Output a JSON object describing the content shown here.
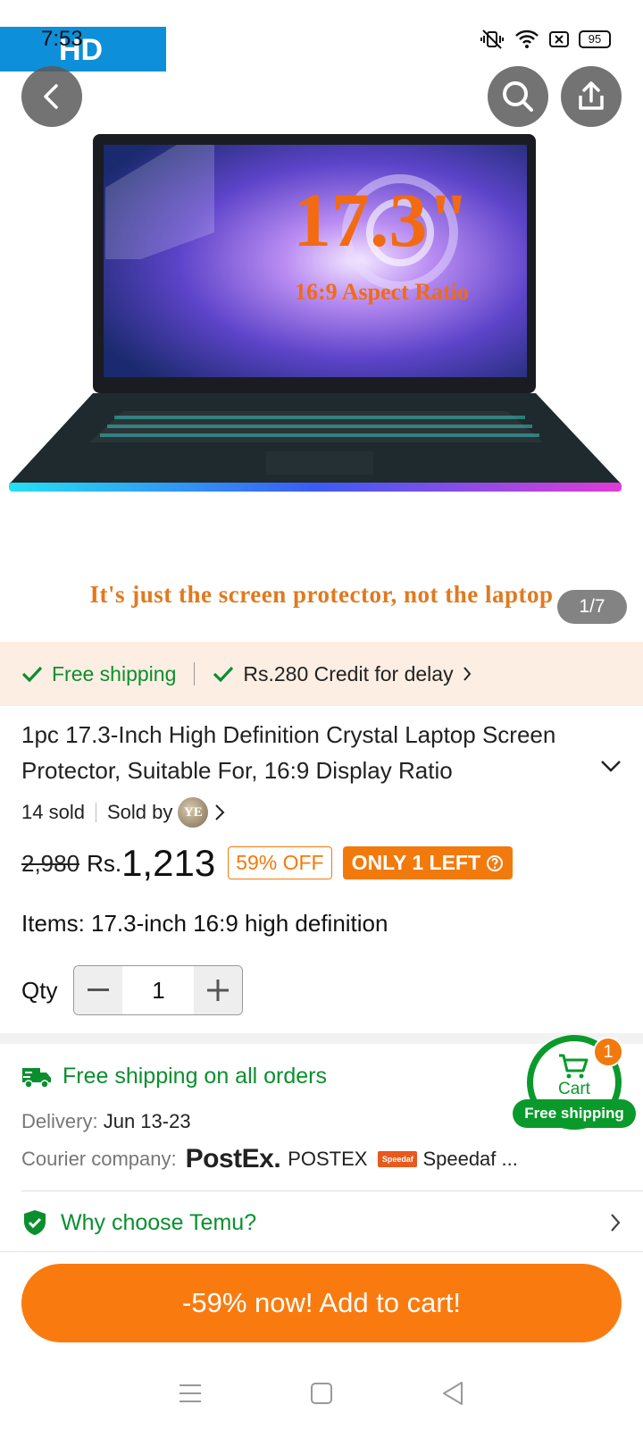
{
  "status": {
    "time": "7:53",
    "battery": "95"
  },
  "hero": {
    "hd_badge": "HD",
    "image_text_size": "17.3\"",
    "image_text_ratio": "16:9 Aspect Ratio",
    "caption": "It's just the screen protector, not the laptop",
    "counter": "1/7"
  },
  "shipping_strip": {
    "free_shipping": "Free shipping",
    "credit": "Rs.280 Credit for delay"
  },
  "product": {
    "title": "1pc 17.3-Inch High Definition Crystal Laptop Screen Protector, Suitable For, 16:9 Display Ratio",
    "sold": "14 sold",
    "sold_by": "Sold by",
    "seller_initials": "YE",
    "old_price": "2,980",
    "currency": "Rs.",
    "price": "1,213",
    "discount": "59% OFF",
    "stock": "ONLY 1 LEFT",
    "items": "Items: 17.3-inch 16:9 high definition",
    "qty_label": "Qty",
    "qty_value": "1"
  },
  "delivery": {
    "free_all": "Free shipping on all orders",
    "delivery_label": "Delivery:",
    "delivery_dates": "Jun 13-23",
    "courier_label": "Courier company:",
    "postex_logo": "PostEx.",
    "postex_name": "POSTEX",
    "speedaf_logo": "Speedaf",
    "speedaf_name": "Speedaf ..."
  },
  "cart_float": {
    "label": "Cart",
    "count": "1",
    "free_shipping": "Free shipping"
  },
  "why": {
    "label": "Why choose Temu?"
  },
  "cta": {
    "label": "-59% now! Add to cart!"
  },
  "colors": {
    "accent": "#f97b0f",
    "green": "#0a8f2e",
    "strip_bg": "#fdeee3"
  }
}
